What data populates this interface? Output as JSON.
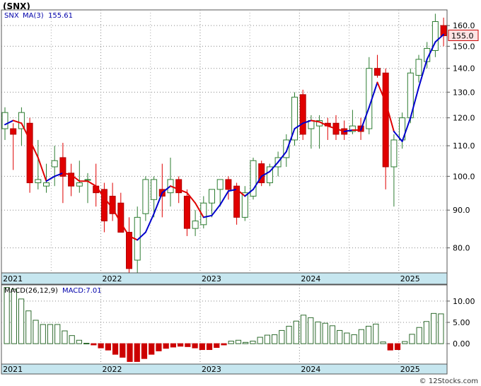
{
  "title": "(SNX)",
  "credit": "© 12Stocks.com",
  "colors": {
    "bullish": "#2e7d32",
    "bearish": "#e00000",
    "ma_up": "#0000cc",
    "ma_down": "#e00000",
    "axis_band": "#c6e6ef",
    "last_price_fill": "#fde3e3",
    "last_price_text": "#cc0000",
    "macd_bar": "#2e6b2e",
    "macd_neg": "#cc0000"
  },
  "chart_data": [
    {
      "type": "candlestick",
      "legend": {
        "symbol": "SNX",
        "ma_label": "MA(3)",
        "ma_value": "155.61"
      },
      "y_scale": "log",
      "ylim": [
        74,
        168
      ],
      "yticks": [
        80,
        90,
        100,
        110,
        120,
        130,
        140,
        150,
        160
      ],
      "ytick_labels": [
        "80.0",
        "90.0",
        "100.0",
        "110.0",
        "120.0",
        "130.0",
        "140.0",
        "150.0",
        "160.0"
      ],
      "last_price": "155.0",
      "last_price_value": 155.0,
      "x_labels": [
        "2021",
        "2022",
        "2023",
        "2024",
        "2025"
      ],
      "x_label_index": [
        0,
        12,
        24,
        36,
        48
      ],
      "candles": [
        {
          "o": 116,
          "h": 124,
          "l": 112,
          "c": 122
        },
        {
          "o": 116,
          "h": 118,
          "l": 102,
          "c": 114
        },
        {
          "o": 116,
          "h": 124,
          "l": 110,
          "c": 122
        },
        {
          "o": 118,
          "h": 120,
          "l": 95,
          "c": 98
        },
        {
          "o": 98,
          "h": 112,
          "l": 96,
          "c": 99
        },
        {
          "o": 97,
          "h": 104,
          "l": 95,
          "c": 98
        },
        {
          "o": 103,
          "h": 110,
          "l": 97,
          "c": 105
        },
        {
          "o": 106,
          "h": 111,
          "l": 92,
          "c": 100
        },
        {
          "o": 101,
          "h": 104,
          "l": 94,
          "c": 97
        },
        {
          "o": 97,
          "h": 105,
          "l": 95,
          "c": 98
        },
        {
          "o": 99,
          "h": 101,
          "l": 92,
          "c": 99
        },
        {
          "o": 97,
          "h": 104,
          "l": 91,
          "c": 95
        },
        {
          "o": 96,
          "h": 98,
          "l": 84,
          "c": 87
        },
        {
          "o": 94,
          "h": 98,
          "l": 87,
          "c": 89
        },
        {
          "o": 92,
          "h": 95,
          "l": 84,
          "c": 84
        },
        {
          "o": 84,
          "h": 88,
          "l": 74,
          "c": 75
        },
        {
          "o": 77,
          "h": 91,
          "l": 73,
          "c": 88
        },
        {
          "o": 89,
          "h": 100,
          "l": 87,
          "c": 99
        },
        {
          "o": 93,
          "h": 100,
          "l": 88,
          "c": 99
        },
        {
          "o": 96,
          "h": 104,
          "l": 88,
          "c": 94
        },
        {
          "o": 95,
          "h": 106,
          "l": 91,
          "c": 99
        },
        {
          "o": 99,
          "h": 100,
          "l": 92,
          "c": 95
        },
        {
          "o": 94,
          "h": 96,
          "l": 83,
          "c": 85
        },
        {
          "o": 85,
          "h": 90,
          "l": 83,
          "c": 87
        },
        {
          "o": 86,
          "h": 94,
          "l": 85,
          "c": 92
        },
        {
          "o": 92,
          "h": 96,
          "l": 88,
          "c": 96
        },
        {
          "o": 96,
          "h": 99,
          "l": 91,
          "c": 99
        },
        {
          "o": 99,
          "h": 100,
          "l": 93,
          "c": 96
        },
        {
          "o": 97,
          "h": 98,
          "l": 86,
          "c": 88
        },
        {
          "o": 88,
          "h": 97,
          "l": 87,
          "c": 95
        },
        {
          "o": 94,
          "h": 106,
          "l": 93,
          "c": 105
        },
        {
          "o": 104,
          "h": 105,
          "l": 97,
          "c": 98
        },
        {
          "o": 98,
          "h": 104,
          "l": 97,
          "c": 103
        },
        {
          "o": 103,
          "h": 108,
          "l": 100,
          "c": 106
        },
        {
          "o": 106,
          "h": 114,
          "l": 103,
          "c": 112
        },
        {
          "o": 112,
          "h": 130,
          "l": 110,
          "c": 128
        },
        {
          "o": 129,
          "h": 131,
          "l": 112,
          "c": 114
        },
        {
          "o": 116,
          "h": 121,
          "l": 109,
          "c": 119
        },
        {
          "o": 117,
          "h": 121,
          "l": 109,
          "c": 119
        },
        {
          "o": 118,
          "h": 120,
          "l": 112,
          "c": 117
        },
        {
          "o": 118,
          "h": 121,
          "l": 112,
          "c": 114
        },
        {
          "o": 116,
          "h": 119,
          "l": 112,
          "c": 114
        },
        {
          "o": 115,
          "h": 123,
          "l": 114,
          "c": 117
        },
        {
          "o": 117,
          "h": 120,
          "l": 112,
          "c": 115
        },
        {
          "o": 116,
          "h": 145,
          "l": 114,
          "c": 140
        },
        {
          "o": 140,
          "h": 146,
          "l": 136,
          "c": 137
        },
        {
          "o": 138,
          "h": 140,
          "l": 96,
          "c": 103
        },
        {
          "o": 103,
          "h": 114,
          "l": 91,
          "c": 112
        },
        {
          "o": 112,
          "h": 122,
          "l": 109,
          "c": 120
        },
        {
          "o": 120,
          "h": 140,
          "l": 118,
          "c": 138
        },
        {
          "o": 137,
          "h": 146,
          "l": 134,
          "c": 144
        },
        {
          "o": 143,
          "h": 152,
          "l": 140,
          "c": 149
        },
        {
          "o": 148,
          "h": 166,
          "l": 145,
          "c": 162
        },
        {
          "o": 160,
          "h": 164,
          "l": 150,
          "c": 155
        }
      ],
      "ma3": [
        117.5,
        119.0,
        118.0,
        112.0,
        106.0,
        98.5,
        100.0,
        101.0,
        100.5,
        98.5,
        98.5,
        97.0,
        93.5,
        90.5,
        86.5,
        83.0,
        82.0,
        84.0,
        89.0,
        95.0,
        97.0,
        96.0,
        95.0,
        92.0,
        88.0,
        88.5,
        91.5,
        95.5,
        96.0,
        94.0,
        96.0,
        100.0,
        101.5,
        104.5,
        108.0,
        116.0,
        118.0,
        119.0,
        118.5,
        117.0,
        116.0,
        115.0,
        115.5,
        115.5,
        124.0,
        134.0,
        126.0,
        115.0,
        111.5,
        120.0,
        132.0,
        144.0,
        152.0,
        155.61
      ],
      "ma_trend": [
        "down",
        "up",
        "down",
        "down",
        "down",
        "down",
        "up",
        "up",
        "down",
        "down",
        "down",
        "down",
        "down",
        "down",
        "down",
        "down",
        "down",
        "up",
        "up",
        "up",
        "up",
        "down",
        "down",
        "down",
        "down",
        "up",
        "up",
        "up",
        "up",
        "down",
        "up",
        "up",
        "up",
        "up",
        "up",
        "up",
        "up",
        "up",
        "down",
        "down",
        "down",
        "down",
        "up",
        "down",
        "up",
        "up",
        "down",
        "down",
        "up",
        "up",
        "up",
        "up",
        "up",
        "up"
      ]
    },
    {
      "type": "bar",
      "legend": {
        "label": "MACD(26,12,9)",
        "value_label": "MACD:7.01"
      },
      "ylim": [
        -4.8,
        13.8
      ],
      "yticks": [
        0,
        5,
        10
      ],
      "ytick_labels": [
        "0.00",
        "5.00",
        "10.00"
      ],
      "x_labels": [
        "2021",
        "2022",
        "2023",
        "2024",
        "2025"
      ],
      "x_label_index": [
        0,
        12,
        24,
        36,
        48
      ],
      "values": [
        13.2,
        12.8,
        10.5,
        7.7,
        5.5,
        4.5,
        4.5,
        4.5,
        3.0,
        1.9,
        0.8,
        0.1,
        -0.3,
        -1.0,
        -1.5,
        -2.5,
        -3.2,
        -4.2,
        -4.2,
        -3.5,
        -2.5,
        -1.7,
        -1.1,
        -0.8,
        -0.6,
        -0.7,
        -1.0,
        -1.4,
        -1.4,
        -0.9,
        -0.3,
        0.6,
        0.8,
        0.3,
        0.6,
        1.5,
        2.0,
        2.1,
        3.1,
        4.1,
        5.3,
        6.7,
        6.1,
        5.1,
        4.8,
        4.2,
        3.1,
        2.5,
        2.1,
        3.3,
        4.1,
        4.6,
        0.4,
        -1.5,
        -1.4,
        0.5,
        2.2,
        3.8,
        5.2,
        7.1,
        7.0
      ]
    }
  ]
}
